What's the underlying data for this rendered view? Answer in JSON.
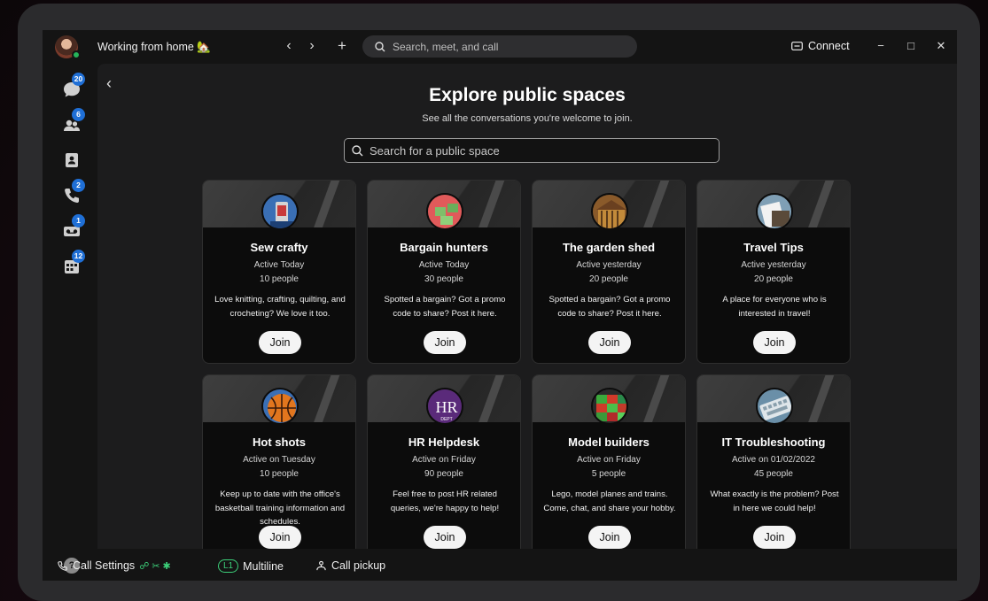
{
  "titlebar": {
    "status": "Working from home 🏡",
    "search_placeholder": "Search, meet, and call",
    "connect_label": "Connect"
  },
  "sidebar": {
    "badges": {
      "messaging": "20",
      "teams": "6",
      "calling": "2",
      "voicemail": "1",
      "meetings": "12"
    },
    "help": "?"
  },
  "main": {
    "title": "Explore public spaces",
    "subtitle": "See all the conversations you're welcome to join.",
    "search_placeholder": "Search for a public space",
    "join_label": "Join",
    "cards": [
      {
        "name": "Sew crafty",
        "active": "Active Today",
        "people": "10 people",
        "desc": "Love knitting, crafting, quilting, and crocheting? We love it too.",
        "icon": "sewing-icon"
      },
      {
        "name": "Bargain hunters",
        "active": "Active Today",
        "people": "30 people",
        "desc": "Spotted a bargain? Got a promo code to share? Post it here.",
        "icon": "bargain-icon"
      },
      {
        "name": "The garden shed",
        "active": "Active yesterday",
        "people": "20 people",
        "desc": "Spotted a bargain? Got a promo code to share? Post it here.",
        "icon": "garden-icon"
      },
      {
        "name": "Travel Tips",
        "active": "Active yesterday",
        "people": "20 people",
        "desc": "A place for everyone who is interested in travel!",
        "icon": "travel-icon"
      },
      {
        "name": "Hot shots",
        "active": "Active on Tuesday",
        "people": "10 people",
        "desc": "Keep up to date with the office's basketball training information and schedules.",
        "icon": "basketball-icon"
      },
      {
        "name": "HR Helpdesk",
        "active": "Active on Friday",
        "people": "90 people",
        "desc": "Feel free to post HR related queries, we're happy to help!",
        "icon": "hr-icon"
      },
      {
        "name": "Model builders",
        "active": "Active on Friday",
        "people": "5 people",
        "desc": "Lego, model planes and trains. Come, chat, and share your hobby.",
        "icon": "lego-icon"
      },
      {
        "name": "IT Troubleshooting",
        "active": "Active on 01/02/2022",
        "people": "45 people",
        "desc": "What exactly is the problem? Post in here we could help!",
        "icon": "keyboard-icon"
      }
    ]
  },
  "bottombar": {
    "call_settings": "Call Settings",
    "line_badge": "L1",
    "multiline": "Multiline",
    "call_pickup": "Call pickup"
  },
  "colors": {
    "accent_blue": "#1f6fd6",
    "presence_green": "#26b35a",
    "line_green": "#3ccf79"
  }
}
